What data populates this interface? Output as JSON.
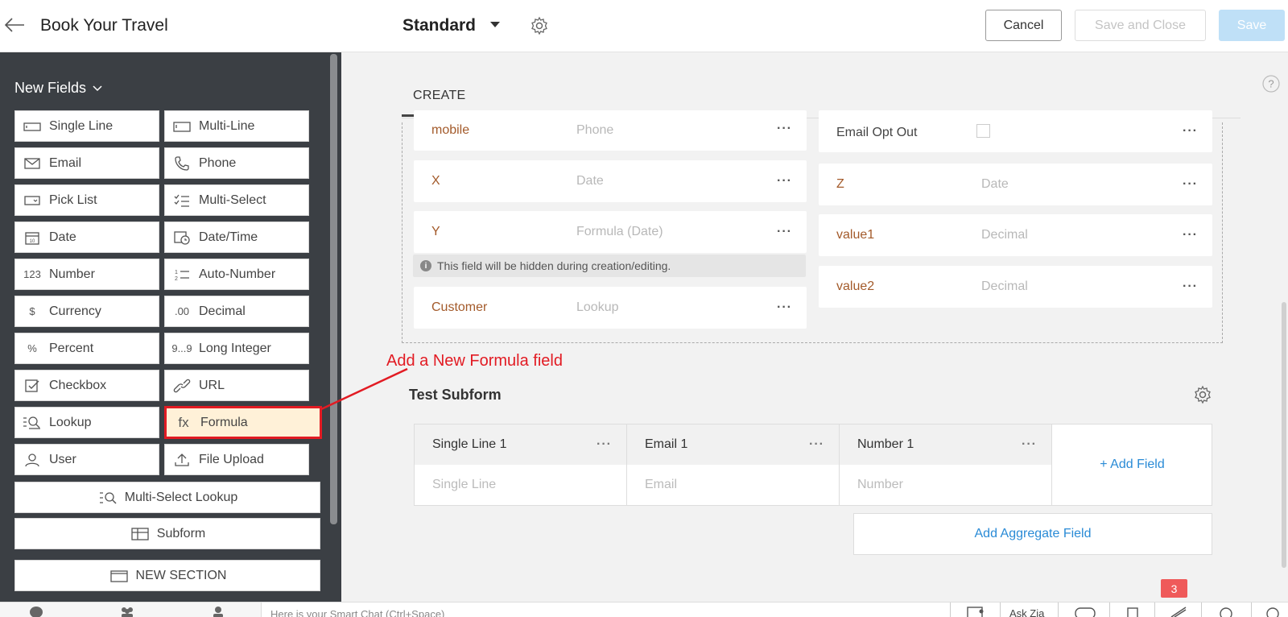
{
  "header": {
    "app_title": "Book Your Travel",
    "layout_name": "Standard",
    "cancel_label": "Cancel",
    "save_close_label": "Save and Close",
    "save_label": "Save"
  },
  "sidebar": {
    "heading": "New Fields",
    "items": [
      {
        "label": "Single Line",
        "icon": "single-line-icon"
      },
      {
        "label": "Multi-Line",
        "icon": "multi-line-icon"
      },
      {
        "label": "Email",
        "icon": "email-icon"
      },
      {
        "label": "Phone",
        "icon": "phone-icon"
      },
      {
        "label": "Pick List",
        "icon": "picklist-icon"
      },
      {
        "label": "Multi-Select",
        "icon": "multi-select-icon"
      },
      {
        "label": "Date",
        "icon": "calendar-icon"
      },
      {
        "label": "Date/Time",
        "icon": "datetime-icon"
      },
      {
        "label": "Number",
        "icon": "number-icon",
        "glyph": "123"
      },
      {
        "label": "Auto-Number",
        "icon": "auto-number-icon"
      },
      {
        "label": "Currency",
        "icon": "currency-icon",
        "glyph": "$"
      },
      {
        "label": "Decimal",
        "icon": "decimal-icon",
        "glyph": ".00"
      },
      {
        "label": "Percent",
        "icon": "percent-icon",
        "glyph": "%"
      },
      {
        "label": "Long Integer",
        "icon": "long-integer-icon",
        "glyph": "9...9"
      },
      {
        "label": "Checkbox",
        "icon": "checkbox-icon"
      },
      {
        "label": "URL",
        "icon": "link-icon"
      },
      {
        "label": "Lookup",
        "icon": "lookup-icon"
      },
      {
        "label": "Formula",
        "icon": "formula-icon",
        "glyph": "fx"
      },
      {
        "label": "User",
        "icon": "user-icon"
      },
      {
        "label": "File Upload",
        "icon": "upload-icon"
      }
    ],
    "multi_select_lookup": "Multi-Select Lookup",
    "subform": "Subform",
    "new_section": "NEW SECTION"
  },
  "main": {
    "tab": "CREATE",
    "left_fields": [
      {
        "label": "mobile",
        "type": "Phone"
      },
      {
        "label": "X",
        "type": "Date"
      },
      {
        "label": "Y",
        "type": "Formula (Date)"
      },
      {
        "label": "Customer",
        "type": "Lookup"
      }
    ],
    "right_fields": [
      {
        "label": "Email Opt Out",
        "type": ""
      },
      {
        "label": "Z",
        "type": "Date"
      },
      {
        "label": "value1",
        "type": "Decimal"
      },
      {
        "label": "value2",
        "type": "Decimal"
      }
    ],
    "hidden_note": "This field will be hidden during creation/editing.",
    "annotation": "Add a New  Formula field",
    "more_glyph": "···",
    "subform": {
      "title": "Test Subform",
      "columns": [
        {
          "header": "Single Line 1",
          "placeholder": "Single Line"
        },
        {
          "header": "Email 1",
          "placeholder": "Email"
        },
        {
          "header": "Number 1",
          "placeholder": "Number"
        }
      ],
      "add_field": "+ Add Field",
      "aggregate": "Add Aggregate Field"
    }
  },
  "bottombar": {
    "chat_placeholder": "Here is your Smart Chat (Ctrl+Space)",
    "ask_zia": "Ask Zia",
    "notification_count": "3"
  },
  "colors": {
    "sidebar_bg": "#3b3f44",
    "field_label": "#a35a2a",
    "accent_link": "#2a8bd6",
    "annotation_red": "#e21b23",
    "formula_highlight_bg": "#fff1d8"
  }
}
